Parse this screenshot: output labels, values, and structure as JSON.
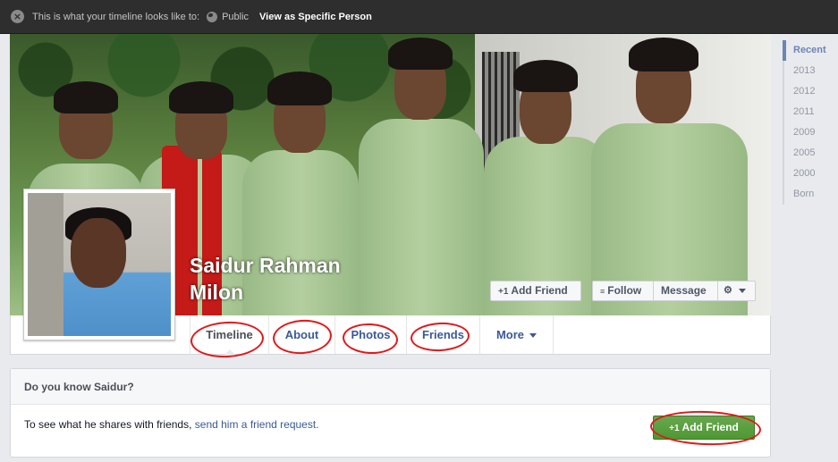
{
  "topbar": {
    "message": "This is what your timeline looks like to:",
    "audience": "Public",
    "view_as": "View as Specific Person"
  },
  "profile": {
    "name": "Saidur Rahman Milon"
  },
  "cover_actions": {
    "add_friend": "Add Friend",
    "follow": "Follow",
    "message": "Message"
  },
  "tabs": [
    "Timeline",
    "About",
    "Photos",
    "Friends",
    "More"
  ],
  "know_box": {
    "title": "Do you know Saidur?",
    "text": "To see what he shares with friends,",
    "link": "send him a friend request.",
    "button": "Add Friend"
  },
  "timeline_rail": [
    "Recent",
    "2013",
    "2012",
    "2011",
    "2009",
    "2005",
    "2000",
    "Born"
  ],
  "colors": {
    "link_blue": "#3b5998",
    "annotation_red": "#e0191a",
    "green_button": "#5ba03f"
  }
}
